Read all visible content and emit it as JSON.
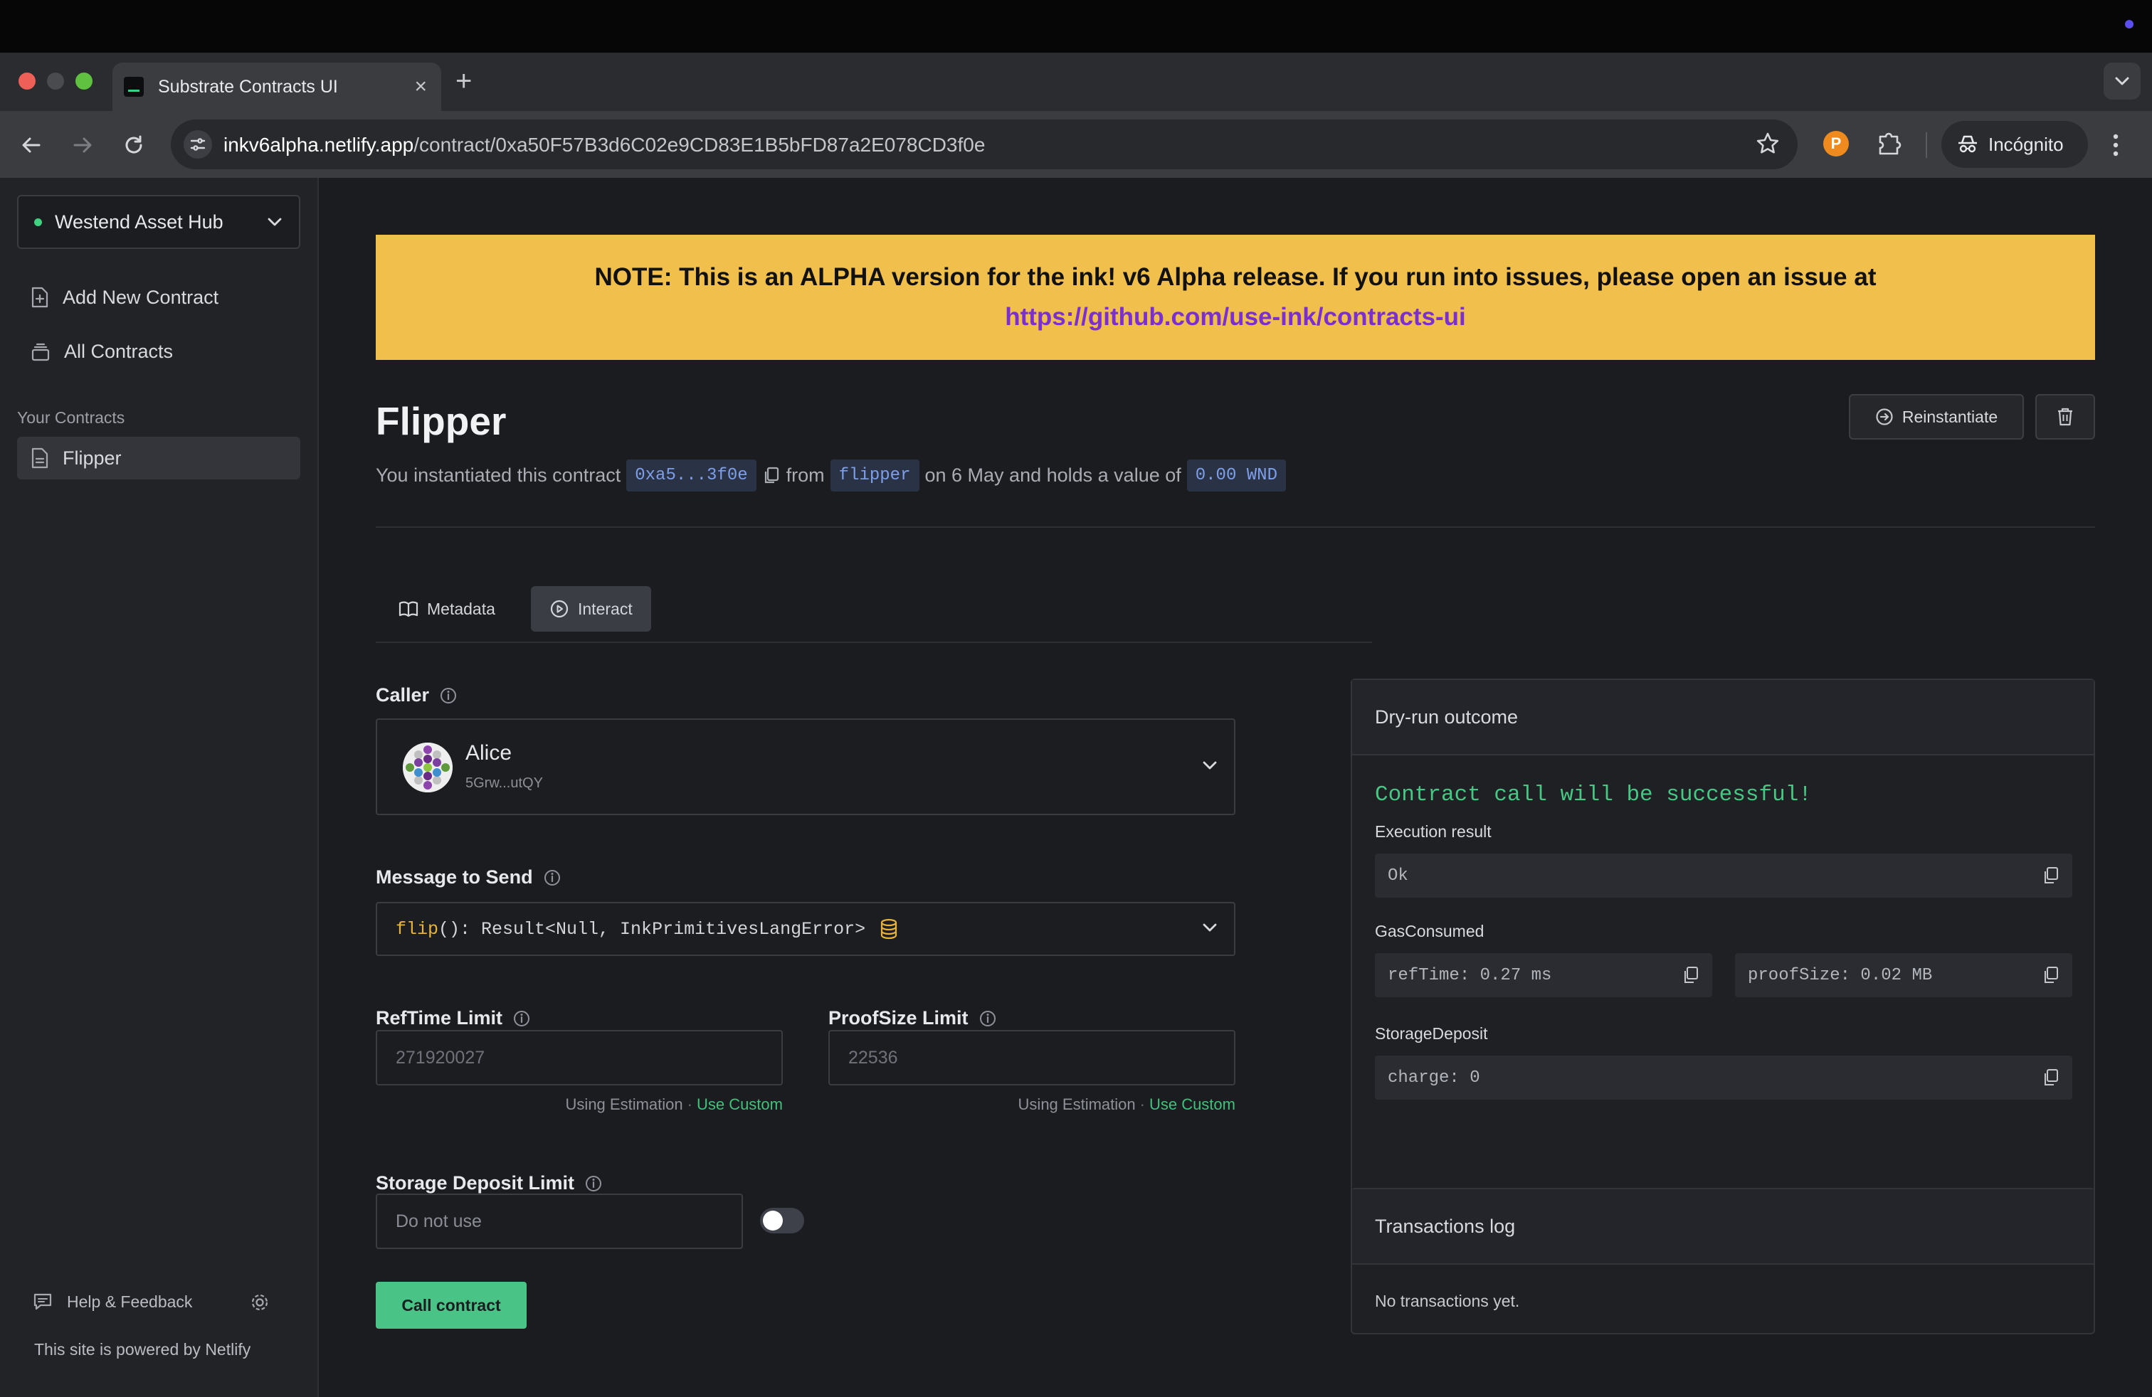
{
  "browser": {
    "tab_title": "Substrate Contracts UI",
    "url_domain": "inkv6alpha.netlify.app",
    "url_path": "/contract/0xa50F57B3d6C02e9CD83E1B5bFD87a2E078CD3f0e",
    "incognito_label": "Incógnito"
  },
  "sidebar": {
    "network": "Westend Asset Hub",
    "items": [
      {
        "label": "Add New Contract",
        "icon": "file-plus-icon"
      },
      {
        "label": "All Contracts",
        "icon": "stack-icon"
      }
    ],
    "section_heading": "Your Contracts",
    "contracts": [
      {
        "label": "Flipper",
        "icon": "document-icon"
      }
    ],
    "help_label": "Help & Feedback",
    "powered_by": "This site is powered by Netlify"
  },
  "banner": {
    "text": "NOTE: This is an ALPHA version for the ink! v6 Alpha release. If you run into issues, please open an issue at ",
    "link": "https://github.com/use-ink/contracts-ui"
  },
  "contract": {
    "name": "Flipper",
    "reinstantiate_label": "Reinstantiate",
    "line": {
      "prefix": "You instantiated this contract",
      "address": "0xa5...3f0e",
      "from_word": "from",
      "code_name": "flipper",
      "mid": "on 6 May and holds a value of",
      "value": "0.00 WND"
    }
  },
  "tabs": [
    {
      "label": "Metadata",
      "icon": "book-icon"
    },
    {
      "label": "Interact",
      "icon": "play-circle-icon",
      "active": true
    }
  ],
  "form": {
    "caller_label": "Caller",
    "caller": {
      "name": "Alice",
      "address": "5Grw...utQY"
    },
    "message_label": "Message to Send",
    "message": {
      "fn": "flip",
      "sig": "(): Result<Null, InkPrimitivesLangError>"
    },
    "reftime_label": "RefTime Limit",
    "reftime_placeholder": "271920027",
    "proofsize_label": "ProofSize Limit",
    "proofsize_placeholder": "22536",
    "using_estimation": "Using Estimation",
    "separator": "·",
    "use_custom": "Use Custom",
    "storage_label": "Storage Deposit Limit",
    "storage_placeholder": "Do not use",
    "storage_toggle_on": false,
    "call_label": "Call contract"
  },
  "dry_run": {
    "title": "Dry-run outcome",
    "status": "Contract call will be successful!",
    "execution_label": "Execution result",
    "execution_value": "Ok",
    "gas_label": "GasConsumed",
    "ref_time": "refTime: 0.27 ms",
    "proof_size": "proofSize: 0.02 MB",
    "storage_label": "StorageDeposit",
    "charge": "charge: 0"
  },
  "tx_log": {
    "title": "Transactions log",
    "empty": "No transactions yet."
  },
  "colors": {
    "banner": "#f0bf4c",
    "accent_green": "#4ac386",
    "link_purple": "#7b2fd0",
    "pill_blue": "#7e9fe8"
  }
}
